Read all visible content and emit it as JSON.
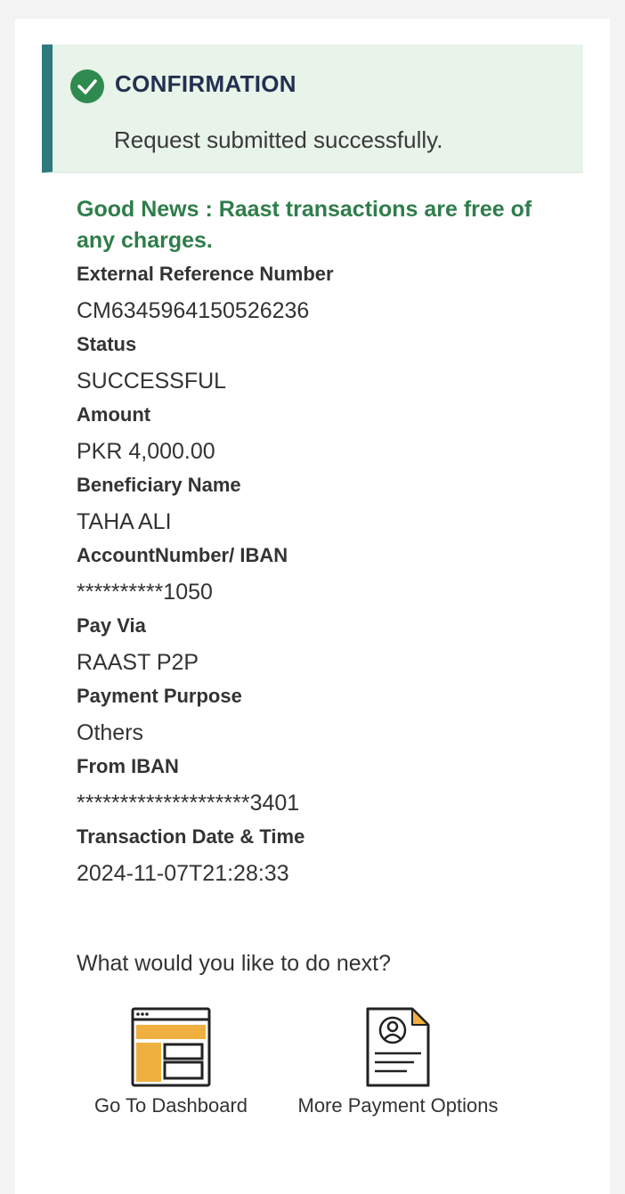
{
  "confirmation": {
    "title": "CONFIRMATION",
    "message": "Request submitted successfully."
  },
  "news": "Good News : Raast transactions are free of any charges.",
  "fields": [
    {
      "label": "External Reference Number",
      "value": "CM6345964150526236"
    },
    {
      "label": "Status",
      "value": "SUCCESSFUL"
    },
    {
      "label": "Amount",
      "value": "PKR 4,000.00"
    },
    {
      "label": "Beneficiary Name",
      "value": "TAHA ALI"
    },
    {
      "label": "AccountNumber/ IBAN",
      "value": "**********1050"
    },
    {
      "label": "Pay Via",
      "value": "RAAST P2P"
    },
    {
      "label": "Payment Purpose",
      "value": "Others"
    },
    {
      "label": "From IBAN",
      "value": "********************3401"
    },
    {
      "label": "Transaction Date & Time",
      "value": "2024-11-07T21:28:33"
    }
  ],
  "next": {
    "title": "What would you like to do next?",
    "actions": [
      {
        "label": "Go To Dashboard",
        "icon": "dashboard-icon"
      },
      {
        "label": "More Payment Options",
        "icon": "document-user-icon"
      }
    ]
  },
  "colors": {
    "accent_bar": "#2c7a7b",
    "success_green": "#2f8a4f",
    "news_green": "#2f7d4a",
    "confirm_bg": "#e8f3e9",
    "icon_orange": "#f0b040"
  }
}
